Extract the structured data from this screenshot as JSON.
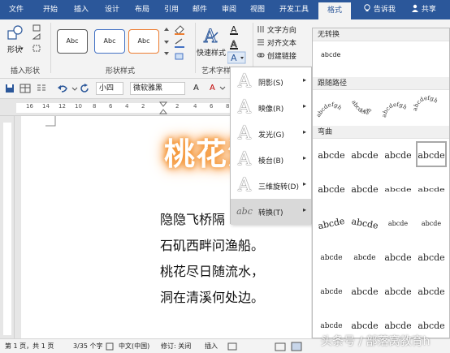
{
  "tabs": [
    "文件",
    "开始",
    "插入",
    "设计",
    "布局",
    "引用",
    "邮件",
    "审阅",
    "视图",
    "开发工具",
    "格式"
  ],
  "active_tab": "格式",
  "tell_me": "告诉我",
  "share": "共享",
  "ribbon": {
    "shape_label": "形状",
    "group_insert_shapes": "插入形状",
    "style_sample": "Abc",
    "group_shape_styles": "形状样式",
    "quick_styles": "快速样式",
    "group_wordart": "艺术字样",
    "text_direction": "文字方向",
    "align_text": "对齐文本",
    "create_link": "创建链接"
  },
  "qbar": {
    "font_size": "小四",
    "font_name": "微软雅黑",
    "font_a": "A",
    "bold": "B"
  },
  "ruler_ticks": [
    "16",
    "14",
    "12",
    "10",
    "8",
    "6",
    "4",
    "2",
    "2",
    "4",
    "6",
    "8"
  ],
  "document": {
    "wordart": "桃花流",
    "poem": [
      "隐隐飞桥隔",
      "石矶西畔问渔船。",
      "桃花尽日随流水，",
      "洞在清溪何处边。"
    ]
  },
  "status": {
    "page": "第 1 页，共 1 页",
    "words": "3/35 个字",
    "lang": "中文(中国)",
    "track": "修订: 关闭",
    "insert": "插入"
  },
  "menu": [
    {
      "icon": "A",
      "label": "阴影(S)"
    },
    {
      "icon": "A",
      "label": "映像(R)"
    },
    {
      "icon": "A",
      "label": "发光(G)"
    },
    {
      "icon": "A",
      "label": "棱台(B)"
    },
    {
      "icon": "A",
      "label": "三维旋转(D)"
    },
    {
      "icon": "abc",
      "label": "转换(T)"
    }
  ],
  "gallery": {
    "no_transform": "无转换",
    "no_transform_sample": "abcde",
    "follow_path": "跟随路径",
    "warp": "弯曲",
    "path_samples": [
      "abcde",
      "abcde",
      "abcde",
      "abcde"
    ],
    "warp_samples": [
      [
        "abcde",
        "abcde",
        "abcde",
        "abcde"
      ],
      [
        "abcde",
        "abcde",
        "abcde",
        "abcde"
      ],
      [
        "abcde",
        "abcde",
        "abcde",
        "abcde"
      ],
      [
        "abcde",
        "abcde",
        "abcde",
        "abcde"
      ],
      [
        "abcde",
        "abcde",
        "abcde",
        "abcde"
      ],
      [
        "abcde",
        "abcde",
        "abcde",
        "abcde"
      ],
      [
        "abcde",
        "abcde",
        "abcde",
        "abcde"
      ]
    ]
  },
  "watermark": "头条号 / 部落窝教育h",
  "colors": {
    "title_bar": "#2b579a",
    "ribbon": "#f3f3f3",
    "style_border_1": "#555555",
    "style_border_2": "#4472c4",
    "style_border_3": "#ed7d31",
    "glow": "#f49331",
    "font_color_red": "#c00000"
  }
}
